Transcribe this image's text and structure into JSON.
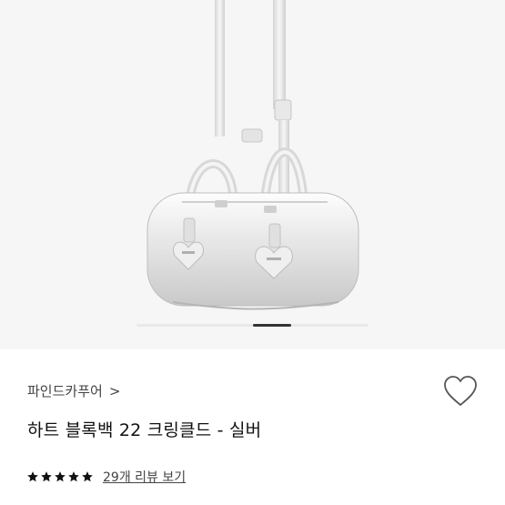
{
  "product": {
    "brand": "파인드카푸어",
    "brand_chevron": ">",
    "title": "하트 블록백 22 크링클드 - 실버",
    "rating_stars": 5,
    "review_link": "29개 리뷰 보기"
  },
  "icons": {
    "brand_chevron": "chevron-right-icon",
    "wish": "heart-outline-icon",
    "star": "star-filled-icon"
  },
  "colors": {
    "image_bg": "#f6f6f6",
    "text_primary": "#111111",
    "text_secondary": "#444444",
    "indicator_active": "#333333"
  }
}
